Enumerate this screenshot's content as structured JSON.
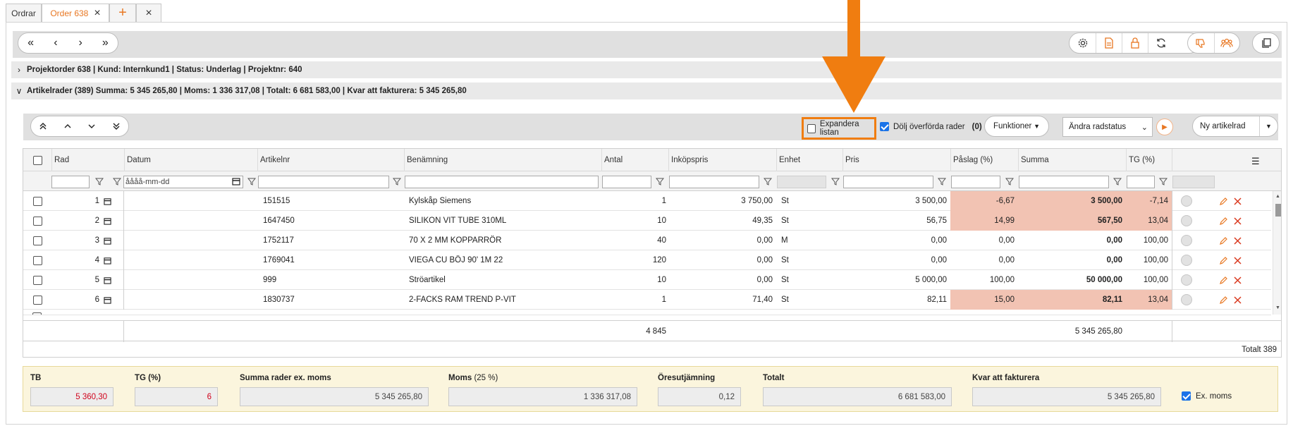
{
  "tabs": [
    {
      "label": "Ordrar"
    },
    {
      "label": "Order 638"
    },
    {
      "label": "+"
    },
    {
      "label": "×"
    }
  ],
  "nav": {
    "first": "«",
    "prev": "‹",
    "next": "›",
    "last": "»"
  },
  "sections": {
    "projekt": "Projektorder 638 | Kund: Internkund1 | Status: Underlag | Projektnr: 640",
    "artikel": "Artikelrader  (389) Summa: 5 345 265,80 | Moms: 1 336 317,08 | Totalt: 6 681 583,00 | Kvar att fakturera: 5 345 265,80"
  },
  "grid_toolbar": {
    "expand_label": "Expandera listan",
    "expand_checked": false,
    "hide_label": "Dölj överförda rader",
    "hide_checked": true,
    "hide_count": "(0)",
    "functions_label": "Funktioner",
    "status_select": "Ändra radstatus",
    "new_row_label": "Ny artikelrad"
  },
  "columns": [
    "Rad",
    "Datum",
    "Artikelnr",
    "Benämning",
    "Antal",
    "Inköpspris",
    "Enhet",
    "Pris",
    "Påslag (%)",
    "Summa",
    "TG (%)"
  ],
  "date_placeholder": "åååå-mm-dd",
  "rows": [
    {
      "rad": "1",
      "artikelnr": "151515",
      "benamning": "Kylskåp Siemens",
      "antal": "1",
      "inkopspris": "3 750,00",
      "enhet": "St",
      "pris": "3 500,00",
      "paslag": "-6,67",
      "summa": "3 500,00",
      "tg": "-7,14",
      "highlight": true
    },
    {
      "rad": "2",
      "artikelnr": "1647450",
      "benamning": "SILIKON VIT TUBE 310ML",
      "antal": "10",
      "inkopspris": "49,35",
      "enhet": "St",
      "pris": "56,75",
      "paslag": "14,99",
      "summa": "567,50",
      "tg": "13,04",
      "highlight": true
    },
    {
      "rad": "3",
      "artikelnr": "1752117",
      "benamning": "70 X 2 MM KOPPARRÖR",
      "antal": "40",
      "inkopspris": "0,00",
      "enhet": "M",
      "pris": "0,00",
      "paslag": "0,00",
      "summa": "0,00",
      "tg": "100,00",
      "highlight": false
    },
    {
      "rad": "4",
      "artikelnr": "1769041",
      "benamning": "VIEGA CU BÖJ 90' 1M 22",
      "antal": "120",
      "inkopspris": "0,00",
      "enhet": "St",
      "pris": "0,00",
      "paslag": "0,00",
      "summa": "0,00",
      "tg": "100,00",
      "highlight": false
    },
    {
      "rad": "5",
      "artikelnr": "999",
      "benamning": "Ströartikel",
      "antal": "10",
      "inkopspris": "0,00",
      "enhet": "St",
      "pris": "5 000,00",
      "paslag": "100,00",
      "summa": "50 000,00",
      "tg": "100,00",
      "highlight": false
    },
    {
      "rad": "6",
      "artikelnr": "1830737",
      "benamning": "2-FACKS RAM TREND P-VIT",
      "antal": "1",
      "inkopspris": "71,40",
      "enhet": "St",
      "pris": "82,11",
      "paslag": "15,00",
      "summa": "82,11",
      "tg": "13,04",
      "highlight": true
    }
  ],
  "grid_totals": {
    "antal": "4 845",
    "summa": "5 345 265,80",
    "count": "Totalt 389"
  },
  "footer": {
    "tb_label": "TB",
    "tb_value": "5 360,30",
    "tg_label": "TG (%)",
    "tg_value": "6",
    "summa_label": "Summa rader ex. moms",
    "summa_value": "5 345 265,80",
    "moms_label": "Moms",
    "moms_pct": "(25 %)",
    "moms_value": "1 336 317,08",
    "ores_label": "Öresutjämning",
    "ores_value": "0,12",
    "totalt_label": "Totalt",
    "totalt_value": "6 681 583,00",
    "kvar_label": "Kvar att fakturera",
    "kvar_value": "5 345 265,80",
    "exmoms_label": "Ex. moms",
    "exmoms_checked": true
  },
  "colors": {
    "accent": "#e87722",
    "highlight_row": "#f2c3b3",
    "arrow": "#f07d10",
    "footer_bg": "#fbf5dd"
  }
}
